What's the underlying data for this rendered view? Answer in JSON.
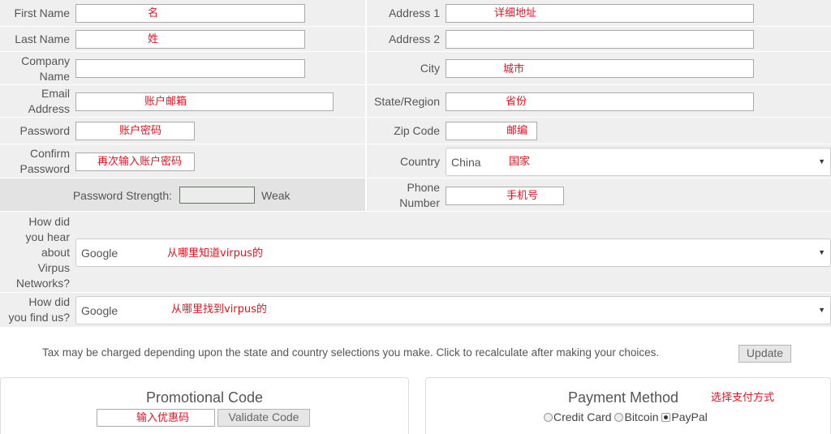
{
  "form": {
    "first_name_label": "First Name",
    "first_name_note": "名",
    "last_name_label": "Last Name",
    "last_name_note": "姓",
    "company_label_1": "Company",
    "company_label_2": "Name",
    "email_label_1": "Email",
    "email_label_2": "Address",
    "email_note": "账户邮箱",
    "password_label": "Password",
    "password_note": "账户密码",
    "confirm_label_1": "Confirm",
    "confirm_label_2": "Password",
    "confirm_note": "再次输入账户密码",
    "strength_label": "Password Strength:",
    "strength_value": "Weak",
    "address1_label": "Address 1",
    "address1_note": "详细地址",
    "address2_label": "Address 2",
    "city_label": "City",
    "city_note": "城市",
    "state_label": "State/Region",
    "state_note": "省份",
    "zip_label": "Zip Code",
    "zip_note": "邮编",
    "country_label": "Country",
    "country_value": "China",
    "country_note": "国家",
    "phone_label_1": "Phone",
    "phone_label_2": "Number",
    "phone_note": "手机号",
    "hear_label": [
      "How did",
      "you hear",
      "about",
      "Virpus",
      "Networks?"
    ],
    "hear_value": "Google",
    "hear_note": "从哪里知道virpus的",
    "find_label_1": "How did",
    "find_label_2": "you find us?",
    "find_value": "Google",
    "find_note": "从哪里找到virpus的"
  },
  "tax": {
    "text": "Tax may be charged depending upon the state and country selections you make. Click to recalculate after making your choices.",
    "update_label": "Update"
  },
  "promo": {
    "title": "Promotional Code",
    "note": "输入优惠码",
    "validate_label": "Validate Code"
  },
  "payment": {
    "title": "Payment Method",
    "note": "选择支付方式",
    "options": [
      "Credit Card",
      "Bitcoin",
      "PayPal"
    ],
    "selected": "PayPal"
  }
}
